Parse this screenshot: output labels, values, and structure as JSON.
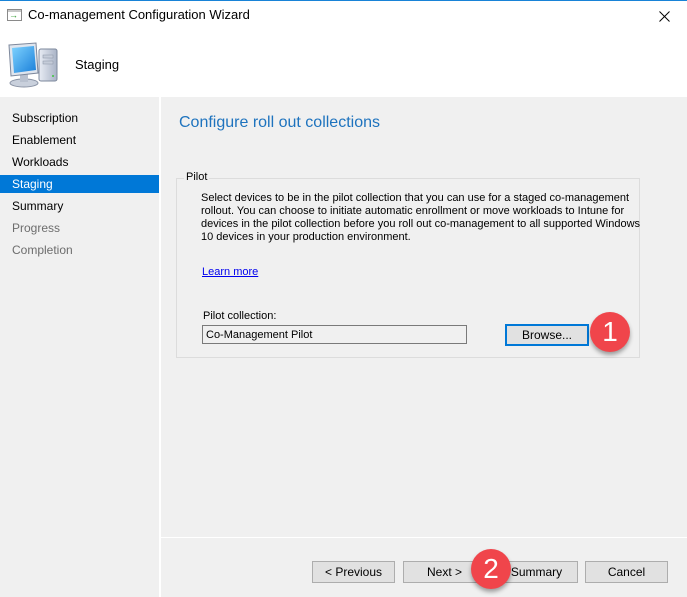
{
  "window": {
    "title": "Co-management Configuration Wizard",
    "close_icon": "close-icon"
  },
  "header": {
    "title": "Staging",
    "icon": "computer-icon"
  },
  "sidebar": {
    "items": [
      {
        "label": "Subscription",
        "state": "normal"
      },
      {
        "label": "Enablement",
        "state": "normal"
      },
      {
        "label": "Workloads",
        "state": "normal"
      },
      {
        "label": "Staging",
        "state": "active"
      },
      {
        "label": "Summary",
        "state": "normal"
      },
      {
        "label": "Progress",
        "state": "disabled"
      },
      {
        "label": "Completion",
        "state": "disabled"
      }
    ]
  },
  "main": {
    "page_title": "Configure roll out collections",
    "pilot_group": {
      "legend": "Pilot",
      "description": "Select devices to be in the pilot collection that you can use for a staged co-management rollout. You can choose to initiate automatic enrollment or move workloads to Intune for devices in the pilot collection before you roll out co-management to all supported Windows 10 devices in your production environment.",
      "learn_more": "Learn more",
      "collection_label": "Pilot collection:",
      "collection_value": "Co-Management Pilot",
      "browse_label": "Browse..."
    }
  },
  "footer": {
    "previous_label": "< Previous",
    "next_label": "Next >",
    "summary_label": "Summary",
    "cancel_label": "Cancel"
  },
  "annotations": [
    {
      "number": "1"
    },
    {
      "number": "2"
    }
  ],
  "colors": {
    "accent": "#0078d7",
    "title_blue": "#1e73be",
    "badge_red": "#f0454b",
    "panel_bg": "#f0f0f0"
  }
}
